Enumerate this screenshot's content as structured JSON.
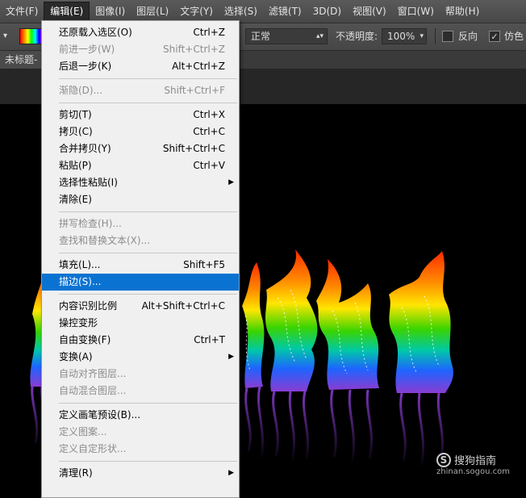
{
  "menubar": {
    "items": [
      "文件(F)",
      "编辑(E)",
      "图像(I)",
      "图层(L)",
      "文字(Y)",
      "选择(S)",
      "滤镜(T)",
      "3D(D)",
      "视图(V)",
      "窗口(W)",
      "帮助(H)"
    ]
  },
  "options": {
    "blend_mode": "正常",
    "opacity_label": "不透明度:",
    "opacity_value": "100%",
    "reverse_label": "反向",
    "dither_label": "仿色"
  },
  "document_tab": {
    "title": "未标题-"
  },
  "edit_menu": {
    "items": [
      {
        "label": "还原载入选区(O)",
        "shortcut": "Ctrl+Z",
        "disabled": false
      },
      {
        "label": "前进一步(W)",
        "shortcut": "Shift+Ctrl+Z",
        "disabled": true
      },
      {
        "label": "后退一步(K)",
        "shortcut": "Alt+Ctrl+Z",
        "disabled": false
      },
      {
        "sep": true
      },
      {
        "label": "渐隐(D)...",
        "shortcut": "Shift+Ctrl+F",
        "disabled": true
      },
      {
        "sep": true
      },
      {
        "label": "剪切(T)",
        "shortcut": "Ctrl+X",
        "disabled": false
      },
      {
        "label": "拷贝(C)",
        "shortcut": "Ctrl+C",
        "disabled": false
      },
      {
        "label": "合并拷贝(Y)",
        "shortcut": "Shift+Ctrl+C",
        "disabled": false
      },
      {
        "label": "粘贴(P)",
        "shortcut": "Ctrl+V",
        "disabled": false
      },
      {
        "label": "选择性粘贴(I)",
        "shortcut": "",
        "submenu": true,
        "disabled": false
      },
      {
        "label": "清除(E)",
        "shortcut": "",
        "disabled": false
      },
      {
        "sep": true
      },
      {
        "label": "拼写检查(H)...",
        "shortcut": "",
        "disabled": true
      },
      {
        "label": "查找和替换文本(X)...",
        "shortcut": "",
        "disabled": true
      },
      {
        "sep": true
      },
      {
        "label": "填充(L)...",
        "shortcut": "Shift+F5",
        "disabled": false
      },
      {
        "label": "描边(S)...",
        "shortcut": "",
        "disabled": false,
        "highlight": true
      },
      {
        "sep": true
      },
      {
        "label": "内容识别比例",
        "shortcut": "Alt+Shift+Ctrl+C",
        "disabled": false
      },
      {
        "label": "操控变形",
        "shortcut": "",
        "disabled": false
      },
      {
        "label": "自由变换(F)",
        "shortcut": "Ctrl+T",
        "disabled": false
      },
      {
        "label": "变换(A)",
        "shortcut": "",
        "submenu": true,
        "disabled": false
      },
      {
        "label": "自动对齐图层...",
        "shortcut": "",
        "disabled": true
      },
      {
        "label": "自动混合图层...",
        "shortcut": "",
        "disabled": true
      },
      {
        "sep": true
      },
      {
        "label": "定义画笔预设(B)...",
        "shortcut": "",
        "disabled": false
      },
      {
        "label": "定义图案...",
        "shortcut": "",
        "disabled": true
      },
      {
        "label": "定义自定形状...",
        "shortcut": "",
        "disabled": true
      },
      {
        "sep": true
      },
      {
        "label": "清理(R)",
        "shortcut": "",
        "submenu": true,
        "disabled": false
      }
    ]
  },
  "watermark": {
    "name": "搜狗指南",
    "url": "zhinan.sogou.com"
  },
  "colors": {
    "rainbow": [
      "#ff2a00",
      "#ff8c00",
      "#ffe600",
      "#39d400",
      "#00c8a8",
      "#1e64ff",
      "#8a3cd2"
    ],
    "menu_highlight": "#0a73d2"
  }
}
